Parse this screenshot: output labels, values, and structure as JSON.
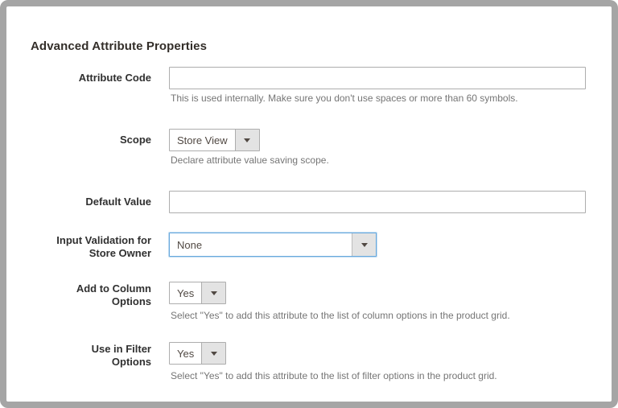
{
  "window": {
    "frame_color": "#a5a5a5",
    "background": "#ffffff"
  },
  "title": "Advanced Attribute Properties",
  "accent": {
    "focus_border": "#68a9dd",
    "input_border": "#adadad",
    "arrow_bg": "#e3e3e3",
    "note_color": "#757575"
  },
  "fields": [
    {
      "id": "attribute-code",
      "label_lines": [
        "Attribute Code"
      ],
      "type": "text",
      "value": "",
      "note": "This is used internally. Make sure you don't use spaces or more than 60 symbols."
    },
    {
      "id": "scope",
      "label_lines": [
        "Scope"
      ],
      "type": "select",
      "value": "Store View",
      "note": "Declare attribute value saving scope."
    },
    {
      "id": "default-value",
      "label_lines": [
        "Default Value"
      ],
      "type": "text",
      "value": ""
    },
    {
      "id": "input-validation-for-store-owner",
      "label_lines": [
        "Input Validation for",
        "Store Owner"
      ],
      "type": "select",
      "value": "None",
      "focused": true
    },
    {
      "id": "add-to-column-options",
      "label_lines": [
        "Add to Column",
        "Options"
      ],
      "type": "select",
      "value": "Yes",
      "note": "Select \"Yes\" to add this attribute to the list of column options in the product grid."
    },
    {
      "id": "use-in-filter-options",
      "label_lines": [
        "Use in Filter",
        "Options"
      ],
      "type": "select",
      "value": "Yes",
      "note": "Select \"Yes\" to add this attribute to the list of filter options in the product grid."
    }
  ]
}
